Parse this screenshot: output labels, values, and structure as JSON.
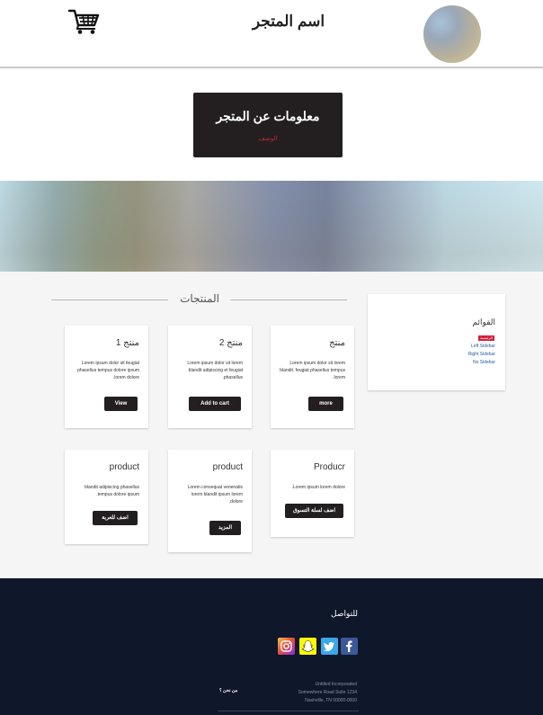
{
  "header": {
    "store_name": "اسم المتجر",
    "cart_icon": "shopping-cart-icon",
    "avatar": "store-logo-avatar"
  },
  "info": {
    "title": "معلومات عن المتجر",
    "description": "الوصف"
  },
  "products_section": {
    "heading": "المنتجات",
    "cards": [
      {
        "title": "منتج",
        "description": "Lorem ipsum dolor sit lorem blandit. feugiat phasellus tempus lorem.",
        "button": "more"
      },
      {
        "title": "منتج 2",
        "description": "Lorem ipsum dolor sit lorem blandit adipiscing et feugiat phasellus.",
        "button": "Add to cart"
      },
      {
        "title": "منتج 1",
        "description": "Lorem ipsum dolor sit feugiat phasellus tempus dolore ipsum lorem dolore.",
        "button": "View"
      },
      {
        "title": "Producr",
        "description": "Lorem ipsum lorem dolore.",
        "button": "اضف لسلة التسوق"
      },
      {
        "title": "product",
        "description": "Lorem consequat venenatis lorem blandit ipsum lorem dolore.",
        "button": "المزيد"
      },
      {
        "title": "product",
        "description": "blandit adipiscing phasellus tempus dolore ipsum.",
        "button": "اضف للعربة"
      }
    ]
  },
  "sidebar": {
    "title": "القوائم",
    "active_item": "الرئيسية",
    "links": [
      "Left Sidebar",
      "Right Sidebar",
      "No Sidebar"
    ]
  },
  "footer": {
    "contact_title": "للتواصل",
    "social": [
      "instagram-icon",
      "snapchat-icon",
      "twitter-icon",
      "facebook-icon"
    ],
    "address_lines": [
      "Untitled Incorporated",
      "Somewhere Road Suite 1234",
      "Nashville, TN 00000-0000"
    ],
    "about": "من نحن ؟"
  },
  "colors": {
    "dark": "#231f20",
    "accent_red": "#d1203a",
    "footer_bg": "#0f172a",
    "section_bg": "#f5f5f5"
  }
}
